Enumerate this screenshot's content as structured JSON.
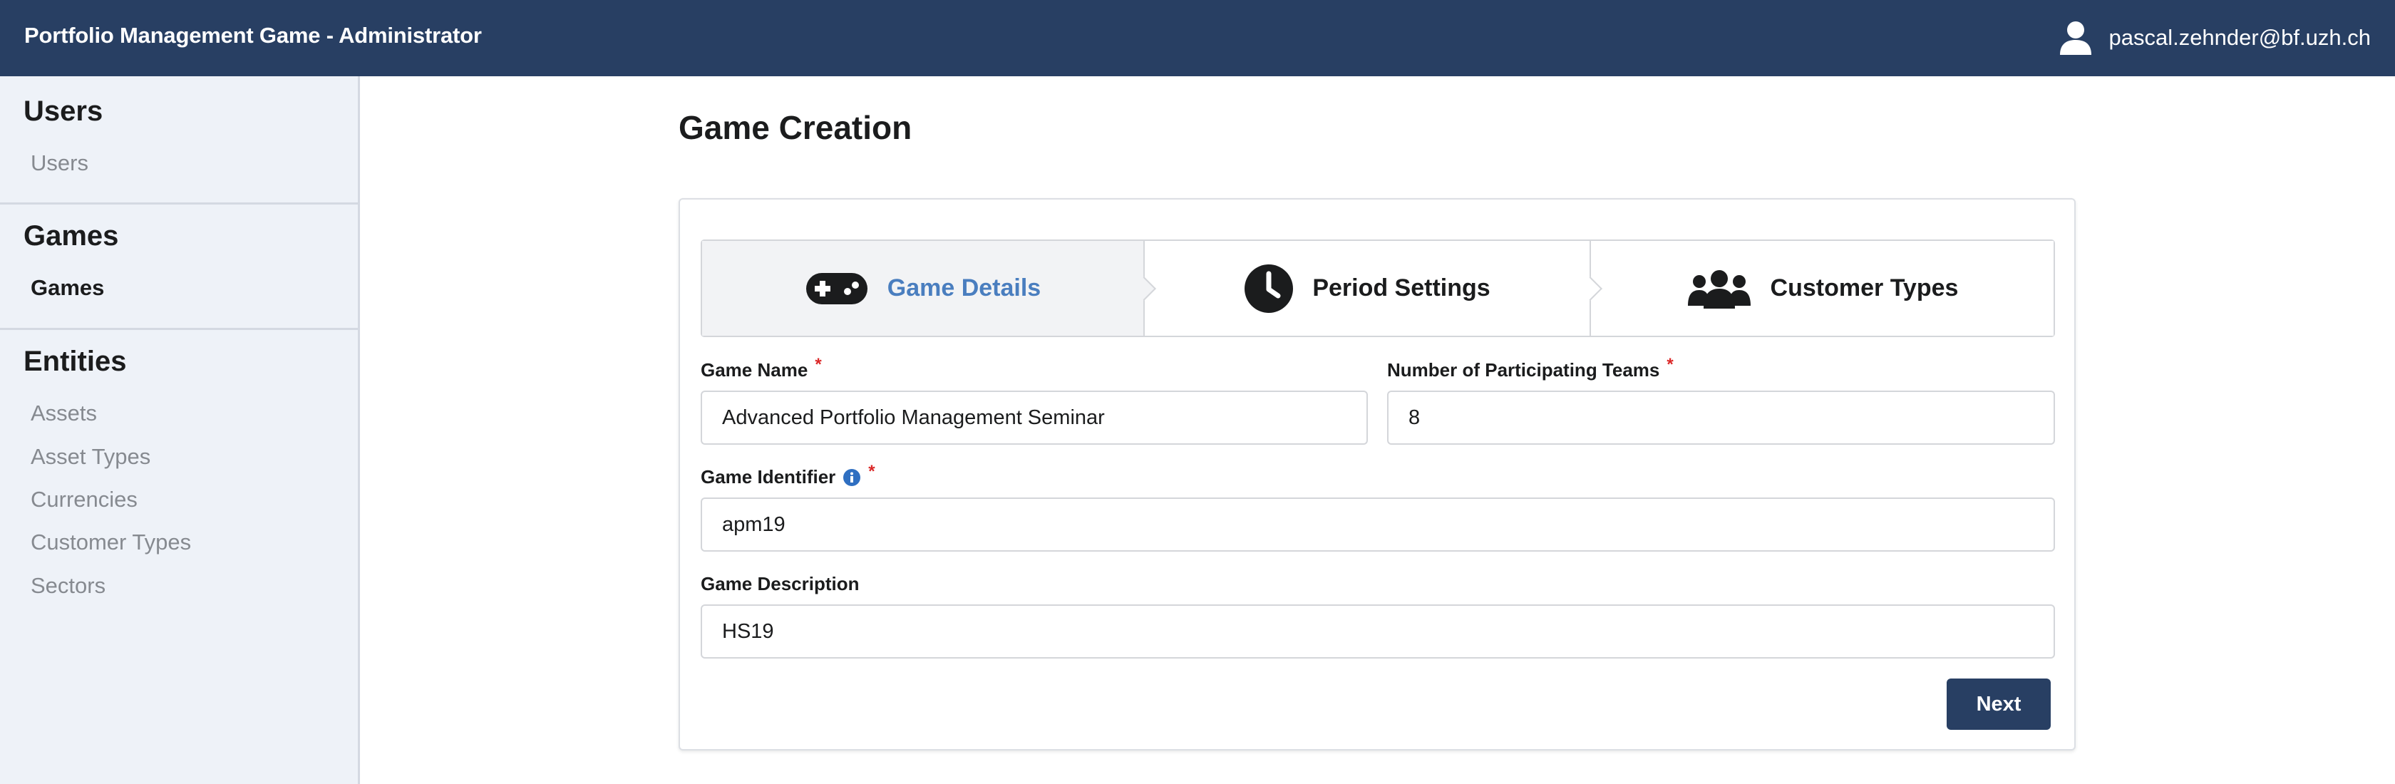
{
  "header": {
    "title": "Portfolio Management Game - Administrator",
    "user_email": "pascal.zehnder@bf.uzh.ch",
    "user_icon": "user-icon"
  },
  "sidebar": {
    "sections": [
      {
        "title": "Users",
        "items": [
          {
            "label": "Users",
            "active": false
          }
        ]
      },
      {
        "title": "Games",
        "items": [
          {
            "label": "Games",
            "active": true
          }
        ]
      },
      {
        "title": "Entities",
        "items": [
          {
            "label": "Assets",
            "active": false
          },
          {
            "label": "Asset Types",
            "active": false
          },
          {
            "label": "Currencies",
            "active": false
          },
          {
            "label": "Customer Types",
            "active": false
          },
          {
            "label": "Sectors",
            "active": false
          }
        ]
      }
    ]
  },
  "main": {
    "title": "Game Creation",
    "steps": [
      {
        "label": "Game Details",
        "icon": "gamepad-icon",
        "active": true
      },
      {
        "label": "Period Settings",
        "icon": "clock-icon",
        "active": false
      },
      {
        "label": "Customer Types",
        "icon": "users-icon",
        "active": false
      }
    ],
    "form": {
      "game_name": {
        "label": "Game Name",
        "value": "Advanced Portfolio Management Seminar",
        "required": "*"
      },
      "teams": {
        "label": "Number of Participating Teams",
        "value": "8",
        "required": "*"
      },
      "identifier": {
        "label": "Game Identifier",
        "value": "apm19",
        "required": "*",
        "info_icon": "info-icon"
      },
      "description": {
        "label": "Game Description",
        "value": "HS19"
      }
    },
    "next_label": "Next"
  },
  "colors": {
    "header_bg": "#283f63",
    "sidebar_bg": "#eef2f8",
    "active_step_text": "#4a7ebf",
    "required": "#db2828",
    "primary_button": "#283f63"
  }
}
